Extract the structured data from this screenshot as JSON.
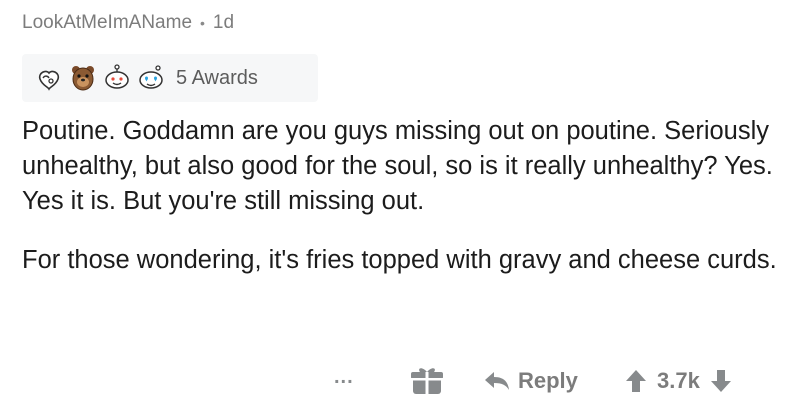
{
  "comment": {
    "author": "LookAtMeImAName",
    "separator": "•",
    "age": "1d",
    "awards_label": "5 Awards",
    "award_icons": [
      "wholesome-hug-icon",
      "bear-gold-icon",
      "reddit-happy-icon",
      "heart-eyes-icon"
    ],
    "paragraphs": [
      "Poutine. Goddamn are you guys missing out on poutine. Seriously unhealthy, but also good for the soul, so is it really unhealthy? Yes. Yes it is. But you're still missing out.",
      "For those wondering, it's fries topped with gravy and cheese curds."
    ]
  },
  "actions": {
    "more_label": "...",
    "reply_label": "Reply",
    "score": "3.7k"
  },
  "colors": {
    "meta_text": "#7c7c7c",
    "body_text": "#1c1c1c",
    "awards_bg": "#f6f7f8",
    "action_gray": "#7c7c7c"
  }
}
